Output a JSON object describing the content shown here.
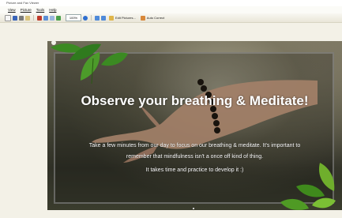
{
  "window": {
    "title": "Picture and Fax Viewer"
  },
  "menu": {
    "items": [
      "View",
      "Picture",
      "Tools",
      "Help"
    ]
  },
  "toolbar": {
    "zoom": "100%",
    "edit_pictures_label": "Edit Pictures...",
    "auto_correct_label": "Auto Correct"
  },
  "slide": {
    "title": "Observe your breathing & Meditate!",
    "body_line1": "Take a few minutes from our day to focus on our breathing & meditate. It's important to",
    "body_line2": "remember that mindfulness isn't a once off kind of thing.",
    "body_line3": "It takes time and practice to develop it :)"
  },
  "colors": {
    "accent": "#2f6fd0",
    "leaf": "#2f7a1e",
    "text": "#ffffff"
  },
  "icons": [
    "new-icon",
    "save-icon",
    "print-icon",
    "email-icon",
    "delete-icon",
    "undo-icon",
    "redo-icon",
    "zoom-in-icon",
    "help-icon",
    "rotate-left-icon",
    "rotate-right-icon",
    "edit-pictures-icon",
    "auto-correct-icon"
  ]
}
